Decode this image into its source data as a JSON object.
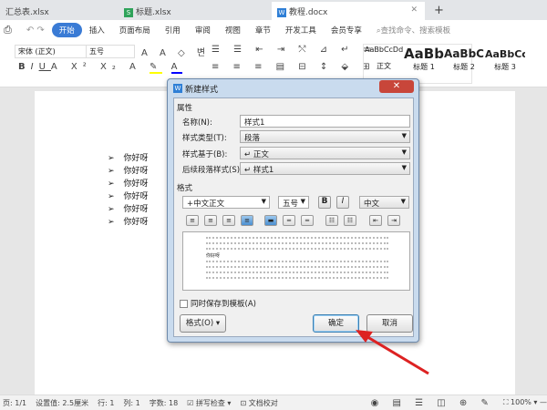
{
  "tabs": [
    {
      "label": "汇总表.xlsx"
    },
    {
      "label": "标题.xlsx",
      "icon": "S"
    },
    {
      "label": "教程.docx",
      "icon": "W"
    }
  ],
  "menu": [
    "开始",
    "插入",
    "页面布局",
    "引用",
    "审阅",
    "视图",
    "章节",
    "开发工具",
    "会员专享"
  ],
  "search_placeholder": "查找命令、搜索模板",
  "toolbar": {
    "font": "宋体 (正文)",
    "size": "五号"
  },
  "styles": [
    {
      "sample": "AaBbCcDd",
      "name": "正文"
    },
    {
      "sample": "AaBb",
      "name": "标题 1"
    },
    {
      "sample": "AaBbC",
      "name": "标题 2"
    },
    {
      "sample": "AaBbCc",
      "name": "标题 3"
    }
  ],
  "document": {
    "bullet": "➢",
    "lines": [
      "你好呀",
      "你好呀",
      "你好呀",
      "你好呀",
      "你好呀",
      "你好呀"
    ]
  },
  "dialog": {
    "title": "新建样式",
    "group_props": "属性",
    "name_label": "名称(N):",
    "name_value": "样式1",
    "type_label": "样式类型(T):",
    "type_value": "段落",
    "based_label": "样式基于(B):",
    "based_value": "↵ 正文",
    "next_label": "后续段落样式(S):",
    "next_value": "↵ 样式1",
    "group_format": "格式",
    "font": "+中文正文",
    "size": "五号",
    "bold": "B",
    "italic": "I",
    "lang": "中文",
    "preview_text": "你好呀",
    "save_template": "同时保存到模板(A)",
    "format_btn": "格式(O)",
    "ok": "确定",
    "cancel": "取消"
  },
  "status": {
    "page": "页: 1/1",
    "setting": "设置值: 2.5厘米",
    "row": "行: 1",
    "col": "列: 1",
    "words": "字数: 18",
    "spell": "拼写检查",
    "proof": "文档校对",
    "zoom": "100%"
  }
}
